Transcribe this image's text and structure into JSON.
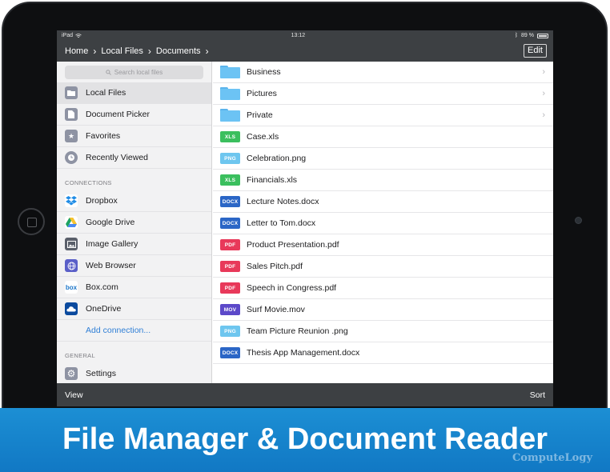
{
  "status_bar": {
    "device": "iPad",
    "time": "13:12",
    "battery": "89 %"
  },
  "nav": {
    "breadcrumb": [
      "Home",
      "Local Files",
      "Documents"
    ],
    "edit_label": "Edit"
  },
  "sidebar": {
    "search_placeholder": "Search local files",
    "top_items": [
      {
        "label": "Local Files",
        "icon": "folder-icon",
        "selected": true
      },
      {
        "label": "Document Picker",
        "icon": "document-icon"
      },
      {
        "label": "Favorites",
        "icon": "star-icon"
      },
      {
        "label": "Recently Viewed",
        "icon": "clock-icon"
      }
    ],
    "connections_header": "CONNECTIONS",
    "connections": [
      {
        "label": "Dropbox",
        "icon": "dropbox-icon"
      },
      {
        "label": "Google Drive",
        "icon": "google-drive-icon"
      },
      {
        "label": "Image Gallery",
        "icon": "image-gallery-icon"
      },
      {
        "label": "Web Browser",
        "icon": "globe-icon"
      },
      {
        "label": "Box.com",
        "icon": "box-icon",
        "icon_text": "box"
      },
      {
        "label": "OneDrive",
        "icon": "onedrive-icon"
      }
    ],
    "add_connection": "Add connection...",
    "general_header": "GENERAL",
    "general": [
      {
        "label": "Settings",
        "icon": "gear-icon"
      }
    ]
  },
  "files": [
    {
      "name": "Business",
      "type": "folder"
    },
    {
      "name": "Pictures",
      "type": "folder"
    },
    {
      "name": "Private",
      "type": "folder"
    },
    {
      "name": "Case.xls",
      "type": "XLS",
      "color": "#3bbf5e"
    },
    {
      "name": "Celebration.png",
      "type": "PNG",
      "color": "#6ec6ef"
    },
    {
      "name": "Financials.xls",
      "type": "XLS",
      "color": "#3bbf5e"
    },
    {
      "name": "Lecture Notes.docx",
      "type": "DOCX",
      "color": "#2b66c6"
    },
    {
      "name": "Letter to Tom.docx",
      "type": "DOCX",
      "color": "#2b66c6"
    },
    {
      "name": "Product Presentation.pdf",
      "type": "PDF",
      "color": "#e8395a"
    },
    {
      "name": "Sales Pitch.pdf",
      "type": "PDF",
      "color": "#e8395a"
    },
    {
      "name": "Speech in Congress.pdf",
      "type": "PDF",
      "color": "#e8395a"
    },
    {
      "name": "Surf Movie.mov",
      "type": "MOV",
      "color": "#5c49c9"
    },
    {
      "name": "Team Picture Reunion .png",
      "type": "PNG",
      "color": "#6ec6ef"
    },
    {
      "name": "Thesis App Management.docx",
      "type": "DOCX",
      "color": "#2b66c6"
    }
  ],
  "toolbar": {
    "view_label": "View",
    "sort_label": "Sort"
  },
  "banner": {
    "title": "File Manager & Document Reader",
    "watermark": "ComputeLogy"
  }
}
